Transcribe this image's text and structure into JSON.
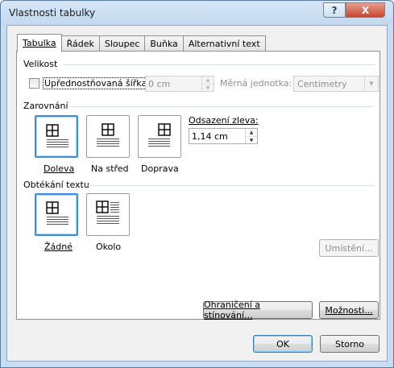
{
  "window": {
    "title": "Vlastnosti tabulky",
    "help_label": "?",
    "close_label": "X"
  },
  "tabs": [
    {
      "label": "Tabulka",
      "active": true
    },
    {
      "label": "Řádek",
      "active": false
    },
    {
      "label": "Sloupec",
      "active": false
    },
    {
      "label": "Buňka",
      "active": false
    },
    {
      "label": "Alternativní text",
      "active": false
    }
  ],
  "size": {
    "heading": "Velikost",
    "preferred_width_label": "Upřednostňovaná šířka:",
    "preferred_width_checked": false,
    "width_value": "0 cm",
    "unit_label": "Měrná jednotka:",
    "unit_value": "Centimetry"
  },
  "alignment": {
    "heading": "Zarovnání",
    "options": [
      {
        "label": "Doleva",
        "selected": true
      },
      {
        "label": "Na střed",
        "selected": false
      },
      {
        "label": "Doprava",
        "selected": false
      }
    ],
    "indent_label": "Odsazení zleva:",
    "indent_value": "1,14 cm"
  },
  "text_wrapping": {
    "heading": "Obtékání textu",
    "options": [
      {
        "label": "Žádné",
        "selected": true
      },
      {
        "label": "Okolo",
        "selected": false
      }
    ],
    "positioning_label": "Umístění..."
  },
  "buttons": {
    "borders_label": "Ohraničení a stínování...",
    "options_label": "Možnosti...",
    "ok_label": "OK",
    "cancel_label": "Storno"
  },
  "colors": {
    "accent": "#3b8ee0",
    "close": "#c6452f"
  }
}
